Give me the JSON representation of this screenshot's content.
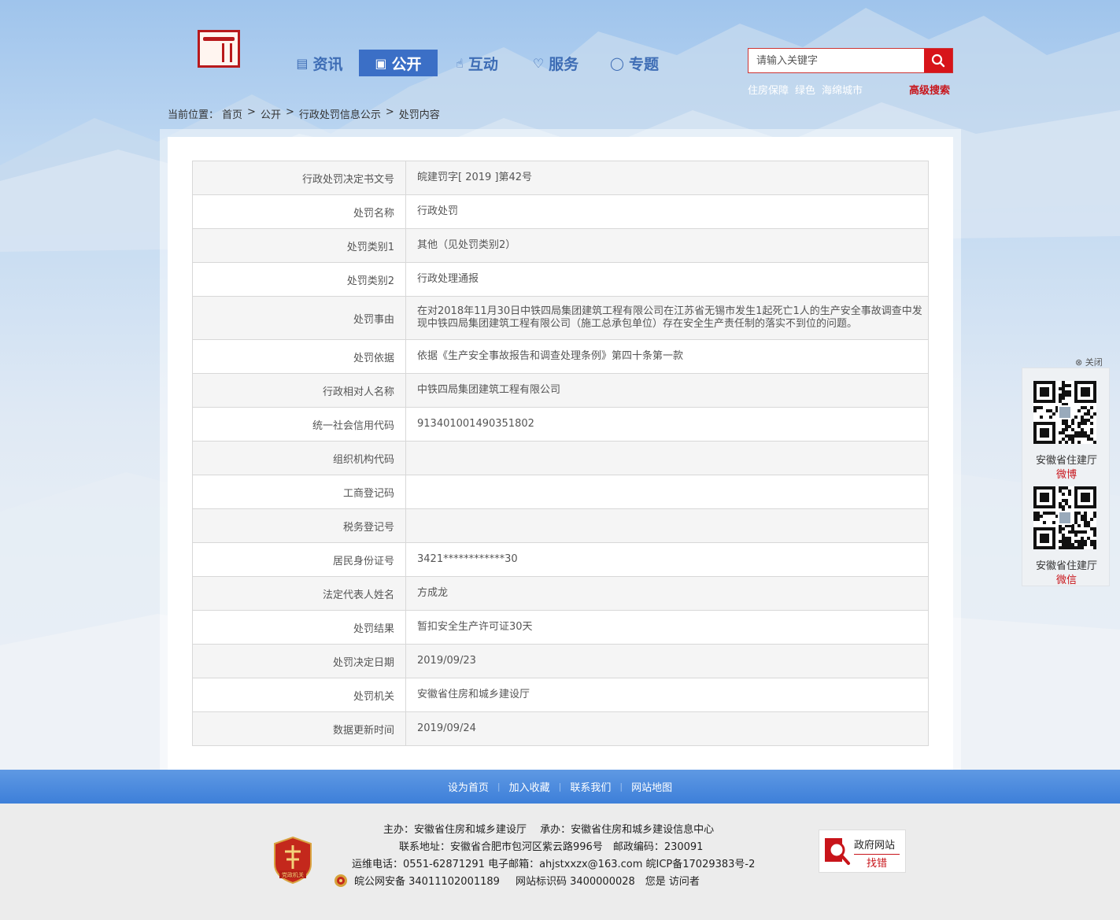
{
  "header": {
    "nav": [
      {
        "label": "资讯",
        "icon": "list-icon",
        "active": false
      },
      {
        "label": "公开",
        "icon": "book-icon",
        "active": true
      },
      {
        "label": "互动",
        "icon": "hand-icon",
        "active": false
      },
      {
        "label": "服务",
        "icon": "heart-icon",
        "active": false
      },
      {
        "label": "专题",
        "icon": "chat-icon",
        "active": false
      }
    ],
    "search": {
      "placeholder": "请输入关键字",
      "value": ""
    },
    "hotwords": [
      "住房保障",
      "绿色",
      "海绵城市"
    ],
    "advanced_search": "高级搜索"
  },
  "breadcrumb": {
    "prefix": "当前位置：",
    "items": [
      "首页",
      "公开",
      "行政处罚信息公示",
      "处罚内容"
    ],
    "sep": ">"
  },
  "record": [
    {
      "label": "行政处罚决定书文号",
      "value": "皖建罚字[ 2019 ]第42号"
    },
    {
      "label": "处罚名称",
      "value": "行政处罚"
    },
    {
      "label": "处罚类别1",
      "value": "其他（见处罚类别2）"
    },
    {
      "label": "处罚类别2",
      "value": "行政处理通报"
    },
    {
      "label": "处罚事由",
      "value": "在对2018年11月30日中铁四局集团建筑工程有限公司在江苏省无锡市发生1起死亡1人的生产安全事故调查中发现中铁四局集团建筑工程有限公司（施工总承包单位）存在安全生产责任制的落实不到位的问题。"
    },
    {
      "label": "处罚依据",
      "value": "依据《生产安全事故报告和调查处理条例》第四十条第一款"
    },
    {
      "label": "行政相对人名称",
      "value": "中铁四局集团建筑工程有限公司"
    },
    {
      "label": "统一社会信用代码",
      "value": "913401001490351802"
    },
    {
      "label": "组织机构代码",
      "value": ""
    },
    {
      "label": "工商登记码",
      "value": ""
    },
    {
      "label": "税务登记号",
      "value": ""
    },
    {
      "label": "居民身份证号",
      "value": "3421************30"
    },
    {
      "label": "法定代表人姓名",
      "value": "方成龙"
    },
    {
      "label": "处罚结果",
      "value": "暂扣安全生产许可证30天"
    },
    {
      "label": "处罚决定日期",
      "value": "2019/09/23"
    },
    {
      "label": "处罚机关",
      "value": "安徽省住房和城乡建设厅"
    },
    {
      "label": "数据更新时间",
      "value": "2019/09/24"
    }
  ],
  "qr_float": {
    "close_label": "关闭",
    "items": [
      {
        "name": "安徽省住建厅",
        "platform": "微博"
      },
      {
        "name": "安徽省住建厅",
        "platform": "微信"
      }
    ]
  },
  "footer": {
    "links": [
      "设为首页",
      "加入收藏",
      "联系我们",
      "网站地图"
    ],
    "host": "主办：安徽省住房和城乡建设厅　 承办：安徽省住房和城乡建设信息中心",
    "address": "联系地址：安徽省合肥市包河区紫云路996号　邮政编码：230091",
    "contact": "运维电话：0551-62871291 电子邮箱：ahjstxxzx@163.com 皖ICP备17029383号-2",
    "police": "皖公网安备 34011102001189",
    "site_id": "网站标识码 3400000028　您是 访问者",
    "emblem_text": "党政机关",
    "error_badge": {
      "line1": "政府网站",
      "line2": "找错"
    }
  }
}
